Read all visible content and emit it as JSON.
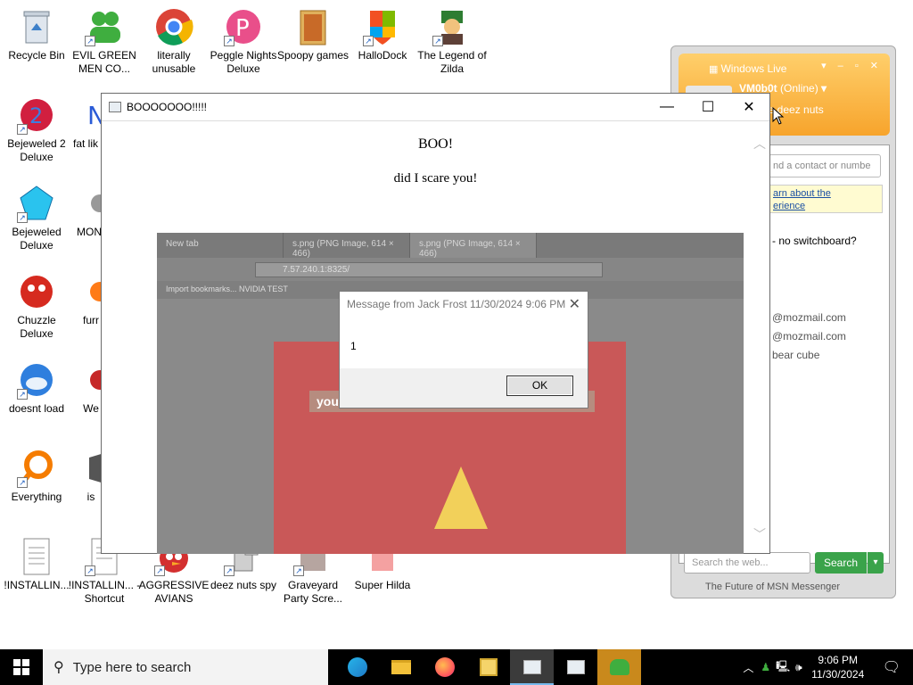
{
  "desktop_icons": [
    {
      "label": "Recycle Bin"
    },
    {
      "label": "EVIL GREEN MEN CO..."
    },
    {
      "label": "literally unusable"
    },
    {
      "label": "Peggle Nights Deluxe"
    },
    {
      "label": "Spoopy games"
    },
    {
      "label": "HalloDock"
    },
    {
      "label": "The Legend of Zilda"
    },
    {
      "label": "Bejeweled 2 Deluxe"
    },
    {
      "label": "fat lik"
    },
    {
      "label": "Bejeweled Deluxe"
    },
    {
      "label": "MON"
    },
    {
      "label": "Chuzzle Deluxe"
    },
    {
      "label": "furr"
    },
    {
      "label": "doesnt load"
    },
    {
      "label": "We"
    },
    {
      "label": "Everything"
    },
    {
      "label": "is"
    },
    {
      "label": "!INSTALLIN..."
    },
    {
      "label": "!INSTALLIN... - Shortcut"
    },
    {
      "label": "AGGRESSIVE AVIANS"
    },
    {
      "label": "deez nuts spy"
    },
    {
      "label": "Graveyard Party Scre..."
    },
    {
      "label": "Super Hilda"
    }
  ],
  "boo_dialog": {
    "title": "BOOOOOOO!!!!!",
    "heading": "BOO!",
    "subtext": "did I scare you!"
  },
  "embedded_browser": {
    "tabs": [
      "New tab",
      "s.png (PNG Image, 614 × 466)",
      "s.png (PNG Image, 614 × 466)"
    ],
    "url": "7.57.240.1:8325/",
    "bookmarks": "Import bookmarks...   NVIDIA TEST",
    "image_text": "you vietham Hacked by google account haha"
  },
  "message_box": {
    "title": "Message from Jack Frost 11/30/2024 9:06 PM",
    "body": "1",
    "ok_label": "OK"
  },
  "msn": {
    "app_title": "Windows Live",
    "user": "VM0b0t",
    "status": "(Online)",
    "personal_message": "late deez nuts",
    "search_contacts_placeholder": "nd a contact or numbe",
    "learn_link": "arn about the",
    "learn_link_2": "erience",
    "notice": "- no switchboard?",
    "contacts": [
      "@mozmail.com",
      "@mozmail.com",
      "bear cube"
    ],
    "web_search_placeholder": "Search the web...",
    "search_button": "Search",
    "footer": "The Future of MSN Messenger"
  },
  "taskbar": {
    "search_placeholder": "Type here to search",
    "time": "9:06 PM",
    "date": "11/30/2024"
  },
  "colors": {
    "taskbar": "#000000",
    "msn_orange": "#f7a42c",
    "search_green": "#3aa34a"
  }
}
